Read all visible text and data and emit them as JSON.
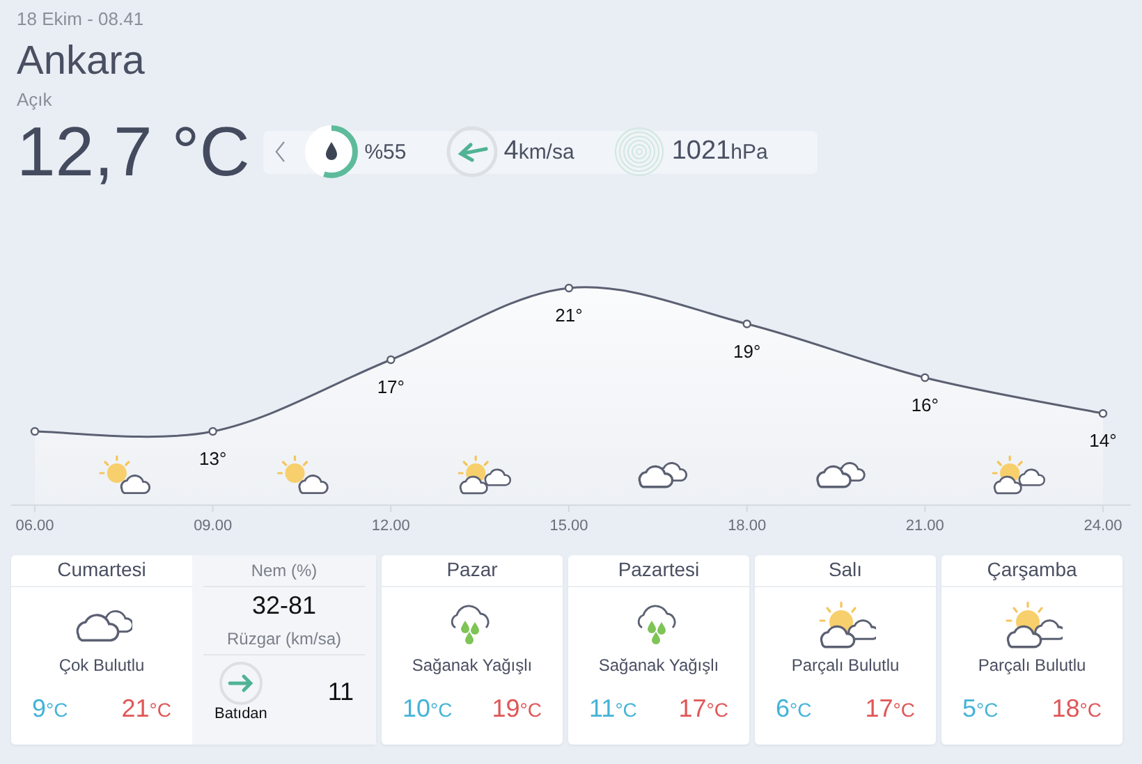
{
  "date": "18 Ekim - 08.41",
  "city": "Ankara",
  "condition": "Açık",
  "temperature": "12,7 °C",
  "stats": {
    "humidity": {
      "value": "%55",
      "level": 0.55
    },
    "wind": {
      "value": "4",
      "unit": "km/sa"
    },
    "pressure": {
      "value": "1021",
      "unit": "hPa"
    }
  },
  "hourly": {
    "chart_data": {
      "type": "area",
      "marker": true,
      "categories": [
        "06.00",
        "09.00",
        "12.00",
        "15.00",
        "18.00",
        "21.00",
        "24.00"
      ],
      "values": [
        13,
        13,
        17,
        21,
        19,
        16,
        14
      ],
      "value_labels": [
        null,
        "13°",
        "17°",
        "21°",
        "19°",
        "16°",
        "14°"
      ]
    },
    "icons": [
      {
        "kind": "sun-cloud"
      },
      {
        "kind": "sun-cloud"
      },
      {
        "kind": "sun-clouds"
      },
      {
        "kind": "clouds"
      },
      {
        "kind": "clouds"
      },
      {
        "kind": "sun-clouds"
      }
    ]
  },
  "today": {
    "day": "Cumartesi",
    "kind": "clouds",
    "condition": "Çok Bulutlu",
    "low": {
      "value": "9",
      "unit": "°C"
    },
    "high": {
      "value": "21",
      "unit": "°C"
    },
    "humidity_label": "Nem (%)",
    "humidity": "32-81",
    "wind_label": "Rüzgar (km/sa)",
    "wind_direction": "Batıdan",
    "wind_speed": "11"
  },
  "days": [
    {
      "day": "Pazar",
      "kind": "rain",
      "condition": "Sağanak Yağışlı",
      "low": {
        "value": "10",
        "unit": "°C"
      },
      "high": {
        "value": "19",
        "unit": "°C"
      }
    },
    {
      "day": "Pazartesi",
      "kind": "rain",
      "condition": "Sağanak Yağışlı",
      "low": {
        "value": "11",
        "unit": "°C"
      },
      "high": {
        "value": "17",
        "unit": "°C"
      }
    },
    {
      "day": "Salı",
      "kind": "sun-clouds",
      "condition": "Parçalı Bulutlu",
      "low": {
        "value": "6",
        "unit": "°C"
      },
      "high": {
        "value": "17",
        "unit": "°C"
      }
    },
    {
      "day": "Çarşamba",
      "kind": "sun-clouds",
      "condition": "Parçalı Bulutlu",
      "low": {
        "value": "5",
        "unit": "°C"
      },
      "high": {
        "value": "18",
        "unit": "°C"
      }
    }
  ]
}
